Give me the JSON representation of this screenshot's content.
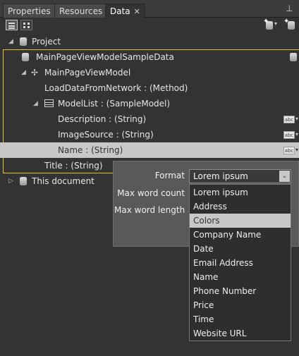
{
  "tabs": [
    {
      "label": "Properties"
    },
    {
      "label": "Resources"
    },
    {
      "label": "Data",
      "close": "✕"
    }
  ],
  "pin_glyph": "⊥",
  "tree": {
    "project": "Project",
    "sample_data": "MainPageViewModelSampleData",
    "view_model": "MainPageViewModel",
    "load_method": "LoadDataFromNetwork : (Method)",
    "model_list": "ModelList : (SampleModel)",
    "description": "Description : (String)",
    "image_source": "ImageSource : (String)",
    "name": "Name : (String)",
    "title": "Title : (String)",
    "this_document": "This document",
    "abc": "abc"
  },
  "popup": {
    "format_label": "Format",
    "format_value": "Lorem ipsum",
    "max_word_count_label": "Max word count",
    "max_word_length_label": "Max word length"
  },
  "dropdown": {
    "options": [
      "Lorem ipsum",
      "Address",
      "Colors",
      "Company Name",
      "Date",
      "Email Address",
      "Name",
      "Phone Number",
      "Price",
      "Time",
      "Website URL"
    ],
    "selected": "Colors"
  }
}
